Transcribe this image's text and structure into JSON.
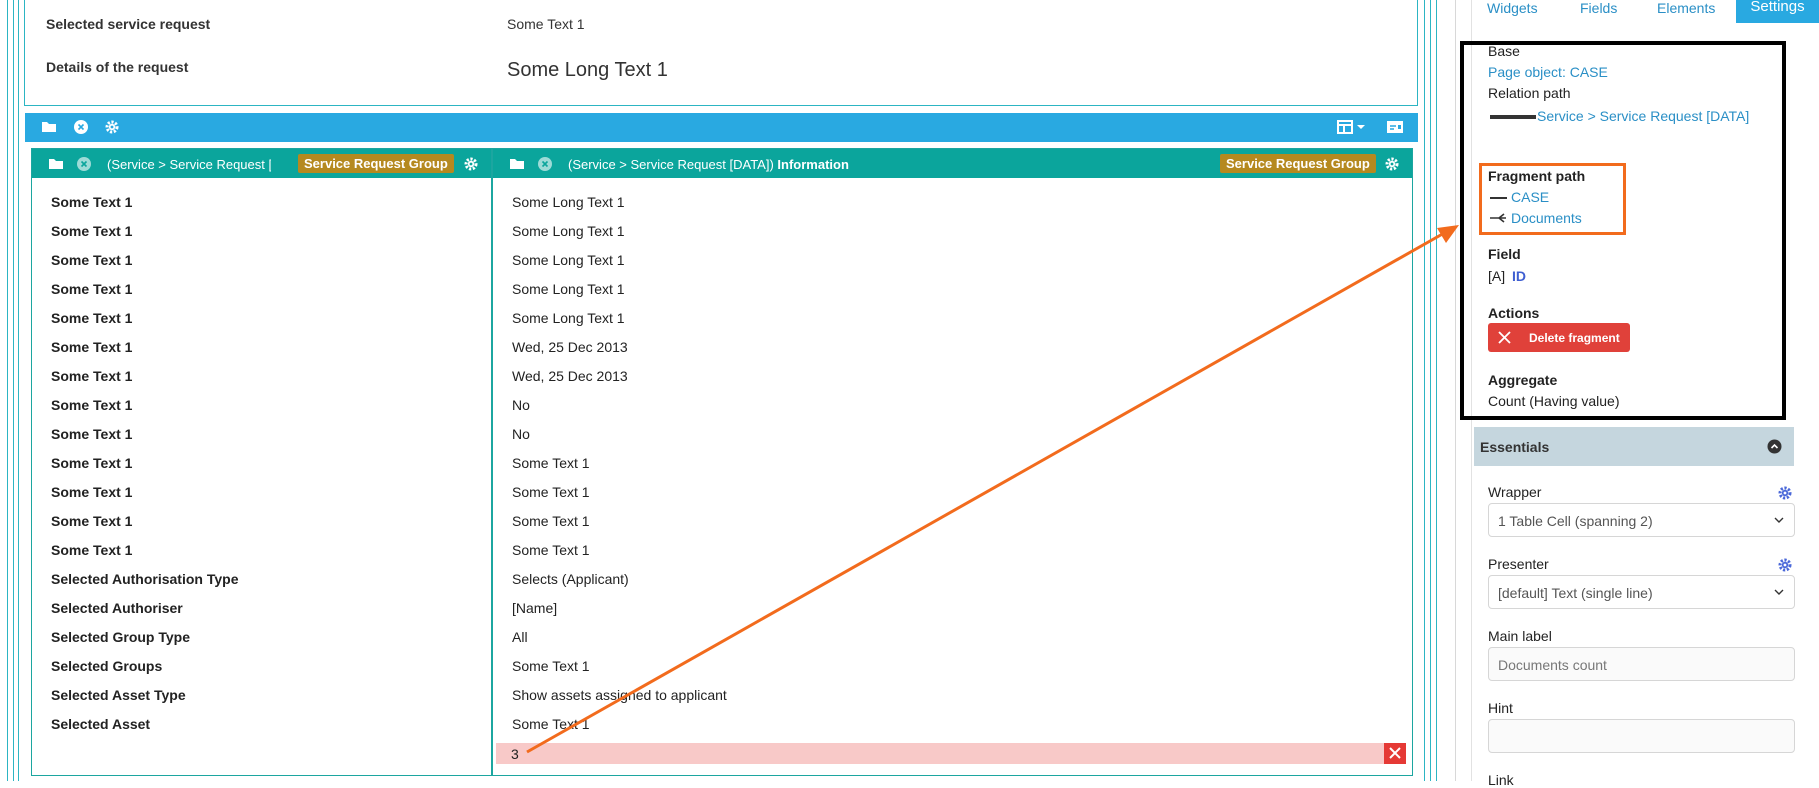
{
  "top_panel": {
    "rows": [
      {
        "label": "Selected service request",
        "value": "Some Text 1"
      },
      {
        "label": "Details of the request",
        "value": "Some Long Text 1"
      }
    ]
  },
  "left_column": {
    "header_text": "(Service > Service Request [",
    "badge": "Service Request Group",
    "labels": [
      "Some Text 1",
      "Some Text 1",
      "Some Text 1",
      "Some Text 1",
      "Some Text 1",
      "Some Text 1",
      "Some Text 1",
      "Some Text 1",
      "Some Text 1",
      "Some Text 1",
      "Some Text 1",
      "Some Text 1",
      "Some Text 1",
      "Selected Authorisation Type",
      "Selected Authoriser",
      "Selected Group Type",
      "Selected Groups",
      "Selected Asset Type",
      "Selected Asset"
    ]
  },
  "right_column": {
    "header_text": "(Service > Service Request [DATA])",
    "header_bold": "Information",
    "badge": "Service Request Group",
    "values": [
      "Some Long Text 1",
      "Some Long Text 1",
      "Some Long Text 1",
      "Some Long Text 1",
      "Some Long Text 1",
      "Wed, 25 Dec 2013",
      "Wed, 25 Dec 2013",
      "No",
      "No",
      "Some Text 1",
      "Some Text 1",
      "Some Text 1",
      "Some Text 1",
      "Selects (Applicant)",
      "[Name]",
      "All",
      "Some Text 1",
      "Show assets assigned to applicant",
      "Some Text 1"
    ],
    "new_row_value": "3"
  },
  "sidebar": {
    "tabs": [
      "Widgets",
      "Fields",
      "Elements",
      "Settings"
    ],
    "active_tab": "Settings",
    "base_label": "Base",
    "page_object": "Page object: CASE",
    "relation_path_label": "Relation path",
    "relation_path": "Service > Service Request [DATA]",
    "fragment_path_label": "Fragment path",
    "fragment_items": [
      "CASE",
      "Documents"
    ],
    "field_label": "Field",
    "field_prefix": "[A]",
    "field_value": "ID",
    "actions_label": "Actions",
    "delete_label": "Delete fragment",
    "aggregate_label": "Aggregate",
    "aggregate_value": "Count (Having value)",
    "essentials_label": "Essentials",
    "wrapper_label": "Wrapper",
    "wrapper_value": "1 Table Cell (spanning 2)",
    "presenter_label": "Presenter",
    "presenter_value": "[default] Text (single line)",
    "main_label_label": "Main label",
    "main_label_placeholder": "Documents count",
    "hint_label": "Hint",
    "link_label": "Link"
  },
  "colors": {
    "toolbar": "#29a9e1",
    "column_header": "#0ba59c",
    "badge": "#b5891f",
    "delete": "#e0413a",
    "highlight_box": "#f26b1d",
    "new_row": "#f8c9c8"
  }
}
